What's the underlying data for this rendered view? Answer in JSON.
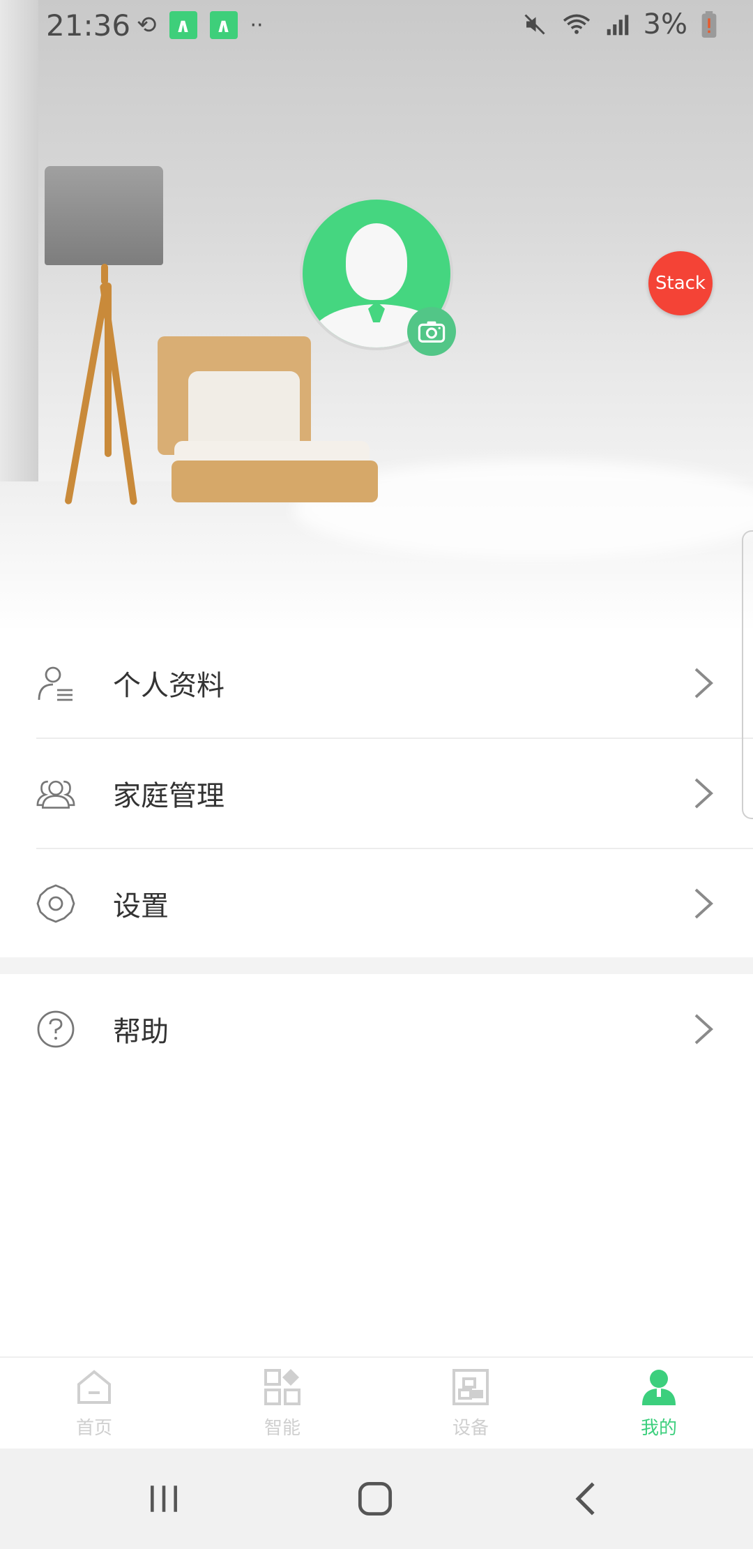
{
  "status_bar": {
    "time": "21:36",
    "battery": "3%",
    "icons": [
      "sync-icon",
      "app-a-icon",
      "app-a-icon",
      "more-dots-icon",
      "mute-icon",
      "wifi-icon",
      "signal-icon",
      "battery-low-icon"
    ]
  },
  "profile": {
    "avatar_icon": "default-avatar-icon",
    "camera_icon": "camera-icon"
  },
  "badge": {
    "label": "Stack"
  },
  "menu": {
    "items": [
      {
        "label": "个人资料",
        "icon": "profile-list-icon"
      },
      {
        "label": "家庭管理",
        "icon": "family-icon"
      },
      {
        "label": "设置",
        "icon": "gear-icon"
      },
      {
        "label": "帮助",
        "icon": "help-icon"
      }
    ]
  },
  "tabs": [
    {
      "label": "首页",
      "icon": "home-icon",
      "active": false
    },
    {
      "label": "智能",
      "icon": "smart-icon",
      "active": false
    },
    {
      "label": "设备",
      "icon": "device-icon",
      "active": false
    },
    {
      "label": "我的",
      "icon": "person-icon",
      "active": true
    }
  ],
  "colors": {
    "accent": "#3ccf7d",
    "badge": "#f44336",
    "text": "#333333",
    "inactive": "#cfcfcf"
  }
}
